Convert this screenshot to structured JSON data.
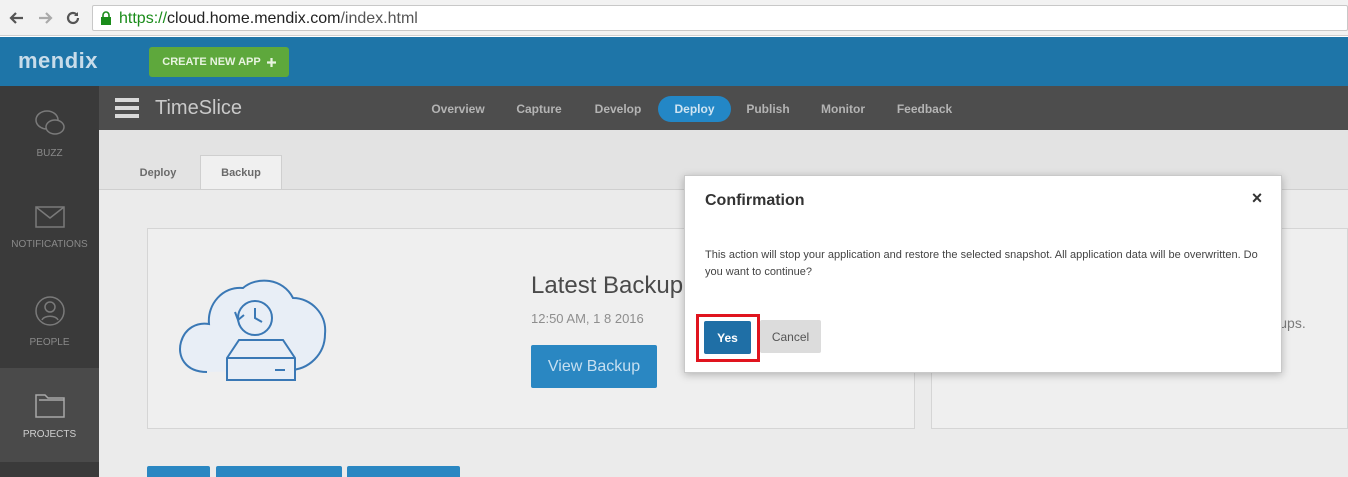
{
  "browser": {
    "url_scheme": "https://",
    "url_host": "cloud.home.mendix.com",
    "url_path": "/index.html"
  },
  "header": {
    "logo": "mendix",
    "create_button": "CREATE NEW APP"
  },
  "sidebar": {
    "items": [
      {
        "label": "BUZZ",
        "icon": "chat-bubbles-icon"
      },
      {
        "label": "NOTIFICATIONS",
        "icon": "envelope-icon"
      },
      {
        "label": "PEOPLE",
        "icon": "person-icon"
      },
      {
        "label": "PROJECTS",
        "icon": "folder-icon",
        "active": true
      }
    ]
  },
  "project": {
    "title": "TimeSlice",
    "tabs": [
      "Overview",
      "Capture",
      "Develop",
      "Deploy",
      "Publish",
      "Monitor",
      "Feedback"
    ],
    "active_tab": "Deploy"
  },
  "subtabs": {
    "items": [
      "Deploy",
      "Backup"
    ],
    "active": "Backup"
  },
  "backup_card": {
    "title": "Latest Backup",
    "date": "12:50 AM, 1 8 2016",
    "button": "View Backup"
  },
  "right_card": {
    "text": "n backups."
  },
  "modal": {
    "title": "Confirmation",
    "close": "×",
    "body": "This action will stop your application and restore the selected snapshot. All application data will be overwritten. Do you want to continue?",
    "yes": "Yes",
    "cancel": "Cancel"
  },
  "colors": {
    "brand_blue": "#1e75a8",
    "create_green": "#5ea83c",
    "primary_button": "#1f6fa6",
    "highlight_red": "#e0141e"
  }
}
